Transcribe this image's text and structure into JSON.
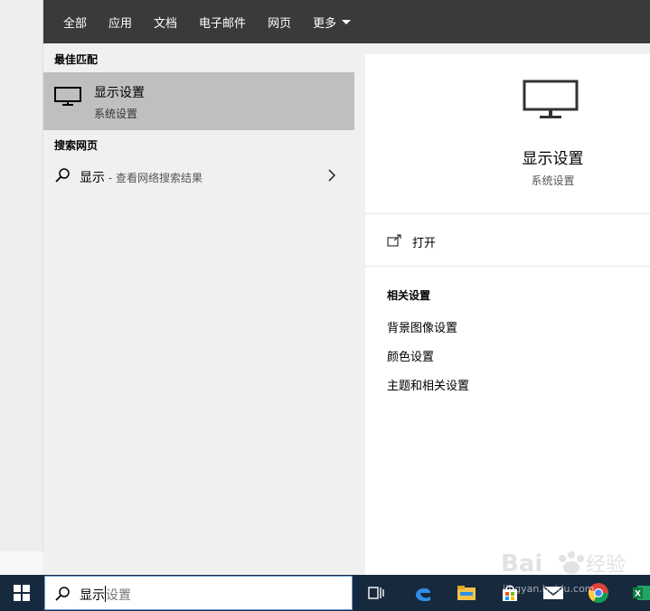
{
  "scope_tabs": [
    {
      "label": "全部"
    },
    {
      "label": "应用"
    },
    {
      "label": "文档"
    },
    {
      "label": "电子邮件"
    },
    {
      "label": "网页"
    },
    {
      "label": "更多"
    }
  ],
  "results": {
    "best_match_heading": "最佳匹配",
    "best_match": {
      "title": "显示设置",
      "subtitle": "系统设置",
      "icon": "monitor-icon"
    },
    "web_heading": "搜索网页",
    "web_item": {
      "text": "显示",
      "hint": " - 查看网络搜索结果",
      "icon": "search-icon"
    }
  },
  "preview": {
    "title": "显示设置",
    "subtitle": "系统设置",
    "open_label": "打开",
    "related_heading": "相关设置",
    "related_links": [
      "背景图像设置",
      "颜色设置",
      "主题和相关设置"
    ]
  },
  "taskbar": {
    "search_typed": "显示",
    "search_hint": "设置",
    "icons": [
      "windows-start-icon",
      "task-view-icon",
      "edge-icon",
      "file-explorer-icon",
      "store-icon",
      "mail-icon",
      "chrome-icon",
      "excel-icon"
    ]
  },
  "colors": {
    "scope_bar": "#3a3a3a",
    "selected_row": "#bfbfbf",
    "taskbar": "#17293d",
    "panel": "#f0f0f0"
  },
  "watermark": {
    "text": "Baidu 经验",
    "url": "jingyan.baidu.com"
  }
}
